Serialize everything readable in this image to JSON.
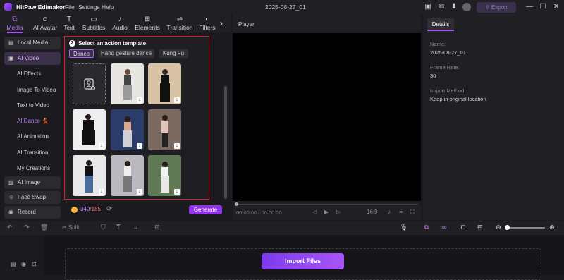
{
  "app": {
    "name": "HitPaw Edimakor",
    "menus": [
      "File",
      "Settings",
      "Help"
    ],
    "document_title": "2025-08-27_01",
    "export_label": "Export"
  },
  "toolbar": {
    "tabs": [
      "Media",
      "AI Avatar",
      "Text",
      "Subtitles",
      "Audio",
      "Elements",
      "Transition",
      "Filters"
    ],
    "active": "Media"
  },
  "sidebar": {
    "items": [
      "Local Media",
      "AI Video",
      "AI Image",
      "Face Swap",
      "Record"
    ],
    "ai_video_subitems": [
      "AI Effects",
      "Image To Video",
      "Text to Video",
      "AI Dance",
      "AI Animation",
      "AI Transition",
      "My Creations"
    ],
    "selected_sub": "AI Dance",
    "ai_dance_emoji": "💃"
  },
  "template_panel": {
    "step_number": "2",
    "title": "Select an action template",
    "categories": [
      "Dance",
      "Hand gesture dance",
      "Kung Fu"
    ],
    "active_category": "Dance",
    "credits_used": "340",
    "credits_separator": "/",
    "credits_total": "185",
    "generate_label": "Generate"
  },
  "player": {
    "label": "Player",
    "timecode": "00:00:00 / 00:00:00",
    "aspect": "16:9"
  },
  "details": {
    "tab": "Details",
    "fields": [
      {
        "label": "Name:",
        "value": "2025-08-27_01"
      },
      {
        "label": "Frame Rate:",
        "value": "30"
      },
      {
        "label": "Import Method:",
        "value": "Keep in original location"
      }
    ]
  },
  "timeline": {
    "split_label": "Split",
    "import_label": "Import Files"
  },
  "colors": {
    "accent": "#a855f7",
    "highlight_border": "#e11d2e",
    "background": "#1b1b1f"
  }
}
